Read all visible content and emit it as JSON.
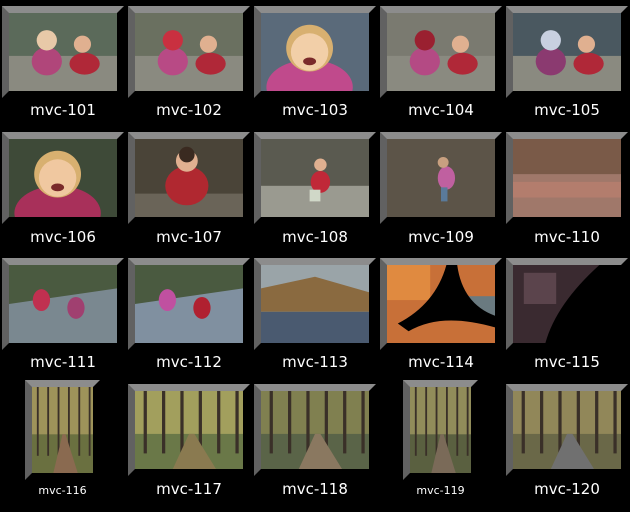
{
  "gallery": {
    "thumbnails": [
      {
        "label": "mvc-101",
        "scene": "kids-on-rock",
        "colors": [
          "#5b6a5a",
          "#b0467a",
          "#e8c9a8"
        ]
      },
      {
        "label": "mvc-102",
        "scene": "kids-on-rock",
        "colors": [
          "#6a7060",
          "#b84a85",
          "#c93040"
        ]
      },
      {
        "label": "mvc-103",
        "scene": "girl-closeup",
        "colors": [
          "#5a6a7a",
          "#c04a8c",
          "#f2cfa8"
        ]
      },
      {
        "label": "mvc-104",
        "scene": "kids-on-rock",
        "colors": [
          "#7a7a70",
          "#b44a84",
          "#9a2030"
        ]
      },
      {
        "label": "mvc-105",
        "scene": "kids-on-rock",
        "colors": [
          "#4a5860",
          "#8b3a70",
          "#c8d0e0"
        ]
      },
      {
        "label": "mvc-106",
        "scene": "girl-closeup",
        "colors": [
          "#3e4a38",
          "#a8305a",
          "#f0c8a0"
        ]
      },
      {
        "label": "mvc-107",
        "scene": "boy-crouching",
        "colors": [
          "#4a4438",
          "#b02830",
          "#e0b090"
        ]
      },
      {
        "label": "mvc-108",
        "scene": "forest-rock",
        "colors": [
          "#5a5a50",
          "#c02838",
          "#d0d8c8"
        ]
      },
      {
        "label": "mvc-109",
        "scene": "forest-floor",
        "colors": [
          "#5c5448",
          "#c060a0",
          "#c8a080"
        ]
      },
      {
        "label": "mvc-110",
        "scene": "lake-reflection",
        "colors": [
          "#6a5448",
          "#a0786a",
          "#c08070"
        ]
      },
      {
        "label": "mvc-111",
        "scene": "rock-slab",
        "colors": [
          "#7a8890",
          "#c03050",
          "#a04070"
        ]
      },
      {
        "label": "mvc-112",
        "scene": "rock-slab",
        "colors": [
          "#8090a0",
          "#c050a0",
          "#b02030"
        ]
      },
      {
        "label": "mvc-113",
        "scene": "lake-hills",
        "colors": [
          "#9aa4a8",
          "#8a6a40",
          "#4a5a70"
        ]
      },
      {
        "label": "mvc-114",
        "scene": "tree-silhouette",
        "colors": [
          "#000000",
          "#c87038",
          "#6a7a80"
        ]
      },
      {
        "label": "mvc-115",
        "scene": "dark-tree",
        "colors": [
          "#000000",
          "#6a5058",
          "#3a2a30"
        ]
      },
      {
        "label": "mvc-116",
        "scene": "forest-path",
        "colors": [
          "#6a7040",
          "#c8b070",
          "#8a6a50"
        ]
      },
      {
        "label": "mvc-117",
        "scene": "forest-path",
        "colors": [
          "#6a7848",
          "#d0c070",
          "#8a7a50"
        ]
      },
      {
        "label": "mvc-118",
        "scene": "forest-path",
        "colors": [
          "#5a6448",
          "#a09858",
          "#8a7860"
        ]
      },
      {
        "label": "mvc-119",
        "scene": "forest-path",
        "colors": [
          "#5a6040",
          "#c0b070",
          "#7a6a58"
        ]
      },
      {
        "label": "mvc-120",
        "scene": "forest-path",
        "colors": [
          "#6a6848",
          "#b0a068",
          "#707070"
        ]
      }
    ]
  }
}
